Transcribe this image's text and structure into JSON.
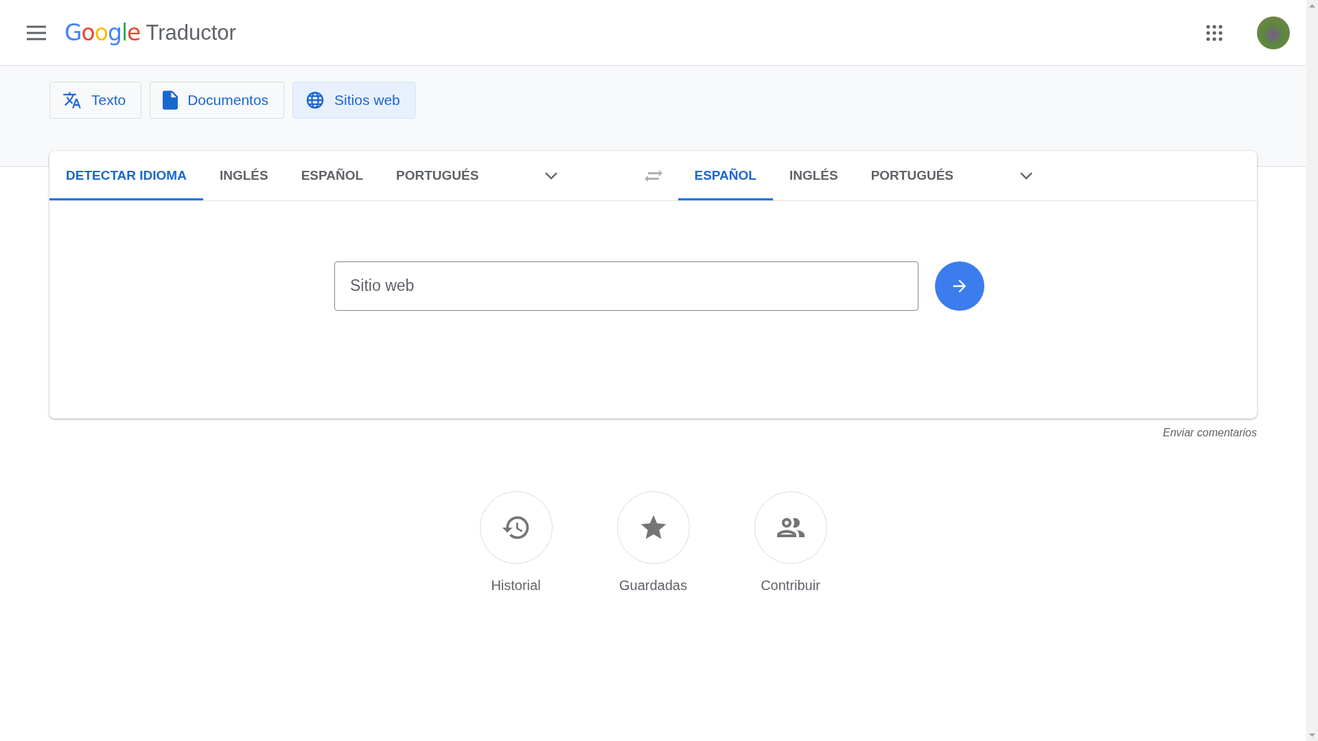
{
  "header": {
    "logo": "Google",
    "product": "Traductor"
  },
  "modes": [
    {
      "kind": "text",
      "label": "Texto",
      "selected": false
    },
    {
      "kind": "documents",
      "label": "Documentos",
      "selected": false
    },
    {
      "kind": "websites",
      "label": "Sitios web",
      "selected": true
    }
  ],
  "source_languages": [
    {
      "label": "DETECTAR IDIOMA",
      "selected": true
    },
    {
      "label": "INGLÉS",
      "selected": false
    },
    {
      "label": "ESPAÑOL",
      "selected": false
    },
    {
      "label": "PORTUGUÉS",
      "selected": false
    }
  ],
  "target_languages": [
    {
      "label": "ESPAÑOL",
      "selected": true
    },
    {
      "label": "INGLÉS",
      "selected": false
    },
    {
      "label": "PORTUGUÉS",
      "selected": false
    }
  ],
  "website_input": {
    "placeholder": "Sitio web"
  },
  "feedback_link": "Enviar comentarios",
  "shortcuts": [
    {
      "kind": "history",
      "label": "Historial"
    },
    {
      "kind": "saved",
      "label": "Guardadas"
    },
    {
      "kind": "contribute",
      "label": "Contribuir"
    }
  ]
}
